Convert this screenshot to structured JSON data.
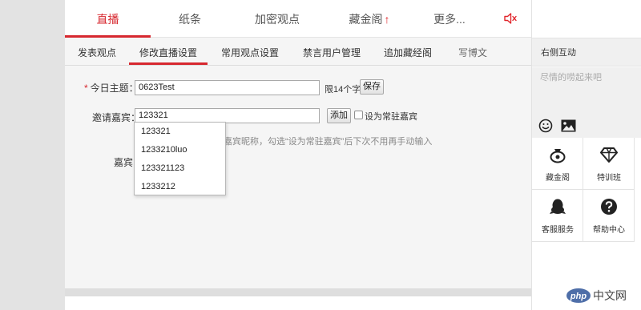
{
  "top_tabs": [
    {
      "label": "直播"
    },
    {
      "label": "纸条"
    },
    {
      "label": "加密观点"
    },
    {
      "label": "藏金阁",
      "arrow": "↑"
    },
    {
      "label": "更多..."
    }
  ],
  "sub_tabs": [
    {
      "label": "发表观点"
    },
    {
      "label": "修改直播设置"
    },
    {
      "label": "常用观点设置"
    },
    {
      "label": "禁言用户管理"
    },
    {
      "label": "追加藏经阁"
    },
    {
      "label": "写博文"
    }
  ],
  "form": {
    "topic_required_mark": "*",
    "topic_label": "今日主题：",
    "topic_value": "0623Test",
    "topic_limit": "限14个字",
    "save_label": "保存",
    "guest_label": "邀请嘉宾：",
    "guest_value": "123321",
    "add_label": "添加",
    "permanent_label": "设为常驻嘉宾",
    "help_text": "嘉宾昵称，勾选“设为常驻嘉宾”后下次不用再手动输入",
    "guests_label": "嘉宾"
  },
  "dropdown_options": [
    "123321",
    "1233210luo",
    "123321123",
    "1233212"
  ],
  "right_panel": {
    "title": "右侧互动",
    "placeholder": "尽情的唠起来吧",
    "services": [
      {
        "label": "藏金阁",
        "icon": "bag-icon"
      },
      {
        "label": "特训班",
        "icon": "diamond-icon"
      },
      {
        "label": "客服服务",
        "icon": "qq-penguin-icon"
      },
      {
        "label": "帮助中心",
        "icon": "help-icon"
      }
    ]
  },
  "watermark": {
    "text": "中文网",
    "logo_text": "php"
  },
  "colors": {
    "accent": "#d7282f",
    "panel_bg": "#f0f0f0",
    "php_blue": "#4e6ea8"
  }
}
